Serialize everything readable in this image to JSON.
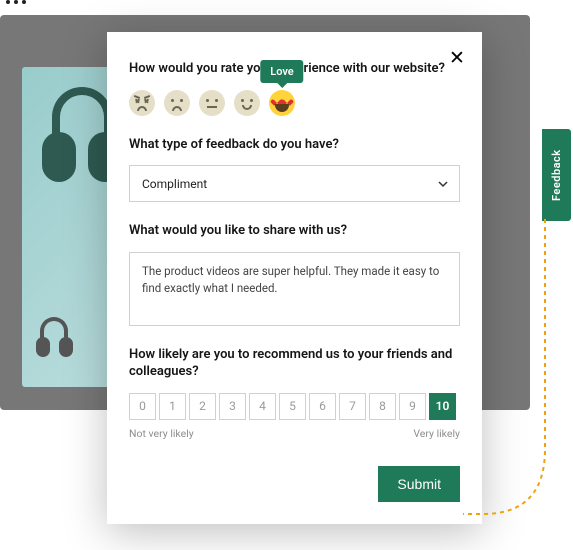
{
  "tooltip_label": "Love",
  "questions": {
    "rating": "How would you rate your experience with our website?",
    "feedback_type": "What type of feedback do you have?",
    "share": "What would you like to share with us?",
    "nps": "How likely are you to recommend us to your friends and colleagues?"
  },
  "select": {
    "value": "Compliment"
  },
  "textarea_value": "The product videos are super helpful. They made it easy to find exactly what I needed.",
  "nps": {
    "options": [
      "0",
      "1",
      "2",
      "3",
      "4",
      "5",
      "6",
      "7",
      "8",
      "9",
      "10"
    ],
    "selected": "10",
    "low_label": "Not very likely",
    "high_label": "Very likely"
  },
  "submit_label": "Submit",
  "feedback_tab_label": "Feedback",
  "emoji_ratings": [
    "angry",
    "sad",
    "neutral",
    "smile",
    "love"
  ],
  "colors": {
    "brand": "#1f7a5a",
    "accent": "#f2a10a"
  }
}
